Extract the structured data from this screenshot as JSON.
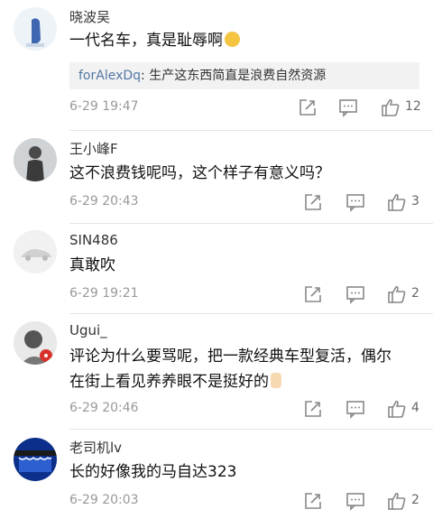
{
  "comments": [
    {
      "username": "晓波吴",
      "text": "一代名车，真是耻辱啊",
      "emoji": "sleepy-face-emoji",
      "quote": {
        "user": "forAlexDq",
        "text": "生产这东西简直是浪费自然资源"
      },
      "time": "6-29 19:47",
      "likes": "12"
    },
    {
      "username": "王小峰F",
      "text": "这不浪费钱呢吗，这个样子有意义吗？",
      "time": "6-29 20:43",
      "likes": "3"
    },
    {
      "username": "SIN486",
      "text": "真敢吹",
      "time": "6-29 19:21",
      "likes": "2"
    },
    {
      "username": "Ugui_",
      "text_line1": "评论为什么要骂呢，把一款经典车型复活，偶尔",
      "text_line2": "在街上看见养养眼不是挺好的",
      "emoji": "victory-hand-emoji",
      "time": "6-29 20:46",
      "likes": "4"
    },
    {
      "username": "老司机lv",
      "text": "长的好像我的马自达323",
      "time": "6-29 20:03",
      "likes": "2"
    }
  ],
  "icons": {
    "share": "share-edit-icon",
    "reply": "comment-bubble-icon",
    "like": "thumbs-up-icon"
  },
  "colors": {
    "quote_user": "#5277a6",
    "meta_gray": "#999999",
    "divider": "#e6e6e6"
  }
}
